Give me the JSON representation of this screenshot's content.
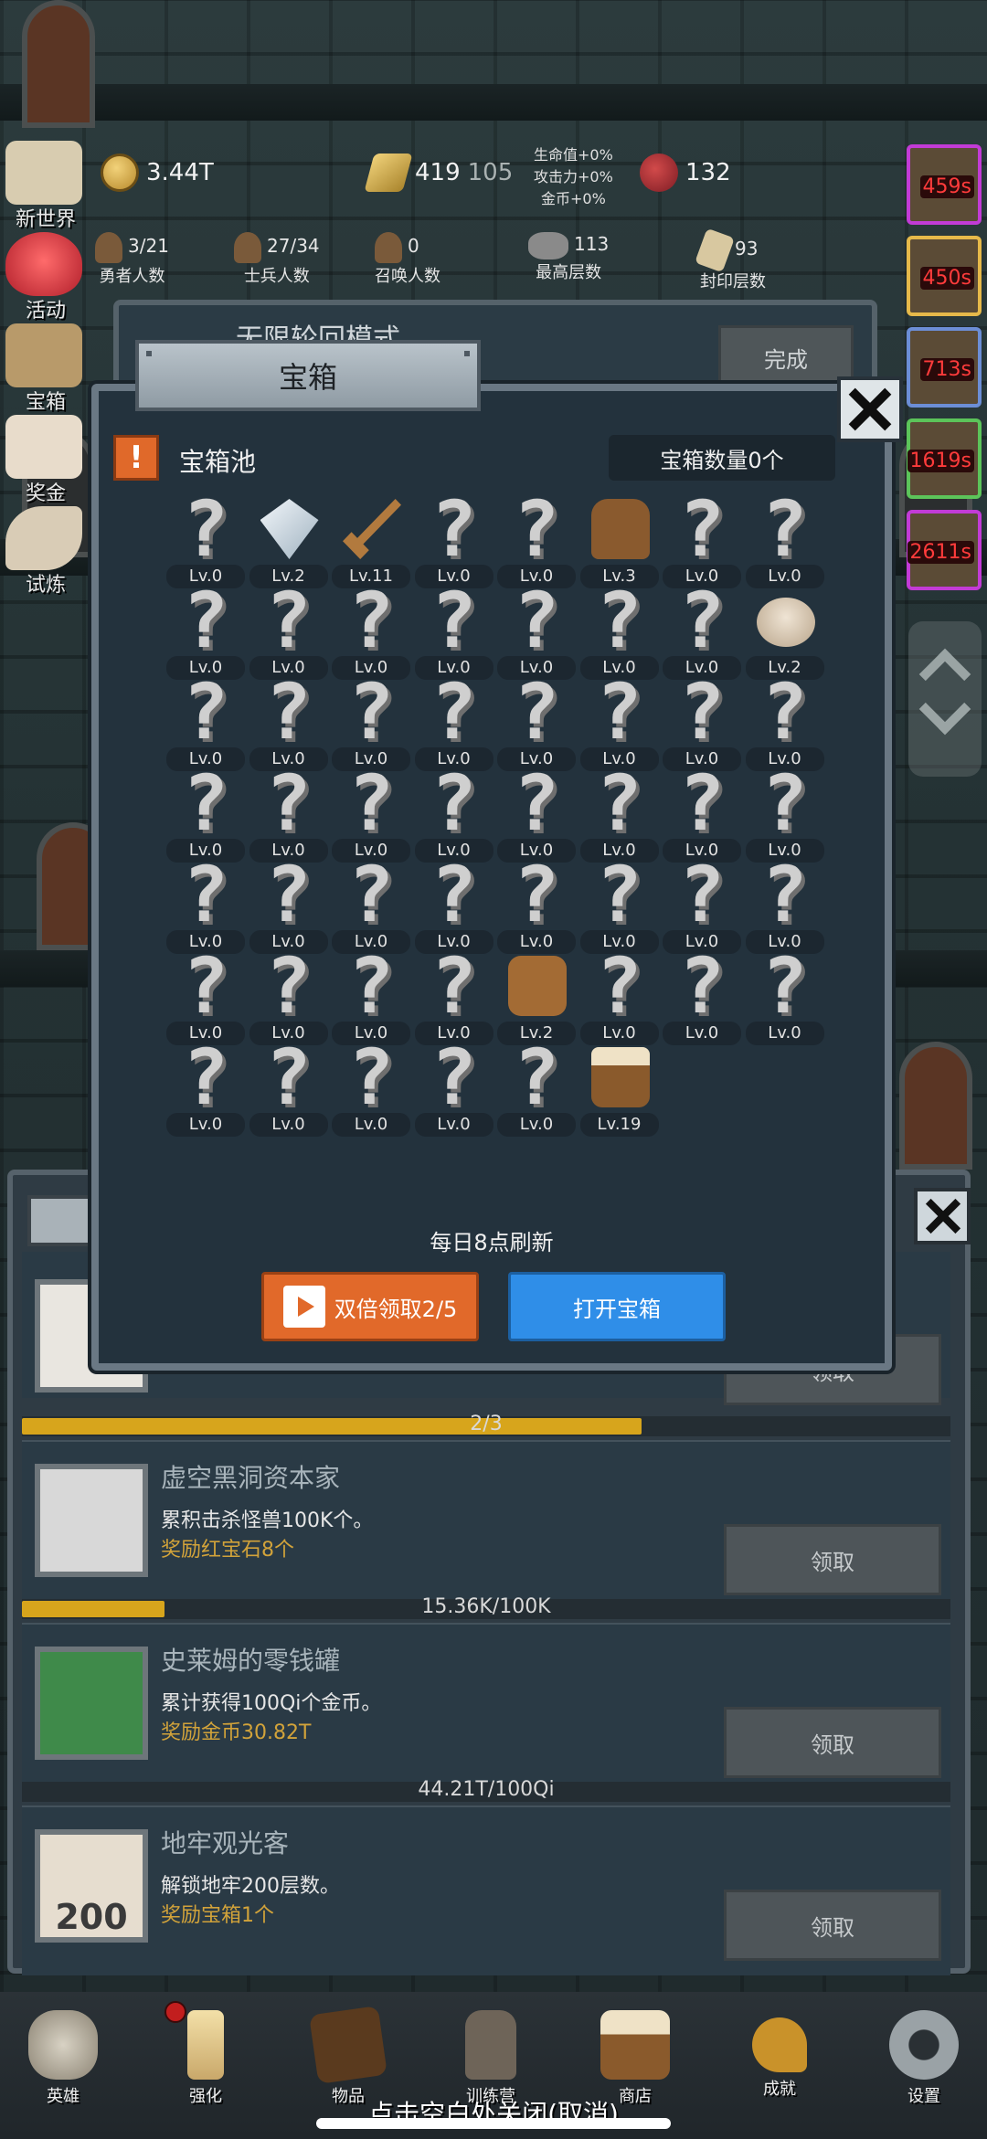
{
  "top_stats": {
    "coins": "3.44T",
    "gold_bars": "419",
    "gold_bars_sub": "105",
    "bonus_lines": [
      "生命值+0%",
      "攻击力+0%",
      "金币+0%"
    ],
    "meat": "132",
    "heroes": {
      "count": "3/21",
      "label": "勇者人数"
    },
    "soldiers": {
      "count": "27/34",
      "label": "士兵人数"
    },
    "summons": {
      "count": "0",
      "label": "召唤人数"
    },
    "highest_floor": {
      "count": "113",
      "label": "最高层数"
    },
    "sealed_floor": {
      "count": "93",
      "label": "封印层数"
    }
  },
  "left_menu": [
    "新世界",
    "活动",
    "宝箱",
    "奖金",
    "试炼"
  ],
  "right_timers": [
    "459s",
    "450s",
    "713s",
    "1619s",
    "2611s"
  ],
  "mode_panel": {
    "title": "无限轮回模式",
    "done_label": "完成"
  },
  "chest_modal": {
    "tab_title": "宝箱",
    "pool_title": "宝箱池",
    "pool_count": "宝箱数量0个",
    "refresh_text": "每日8点刷新",
    "double_claim": "双倍领取2/5",
    "open_chest": "打开宝箱",
    "items": [
      {
        "icon": "unknown",
        "level": "Lv.0"
      },
      {
        "icon": "diamond",
        "level": "Lv.2"
      },
      {
        "icon": "sword",
        "level": "Lv.11"
      },
      {
        "icon": "unknown",
        "level": "Lv.0"
      },
      {
        "icon": "unknown",
        "level": "Lv.0"
      },
      {
        "icon": "armor",
        "level": "Lv.3"
      },
      {
        "icon": "unknown",
        "level": "Lv.0"
      },
      {
        "icon": "unknown",
        "level": "Lv.0"
      },
      {
        "icon": "unknown",
        "level": "Lv.0"
      },
      {
        "icon": "unknown",
        "level": "Lv.0"
      },
      {
        "icon": "unknown",
        "level": "Lv.0"
      },
      {
        "icon": "unknown",
        "level": "Lv.0"
      },
      {
        "icon": "unknown",
        "level": "Lv.0"
      },
      {
        "icon": "unknown",
        "level": "Lv.0"
      },
      {
        "icon": "unknown",
        "level": "Lv.0"
      },
      {
        "icon": "egg",
        "level": "Lv.2"
      },
      {
        "icon": "unknown",
        "level": "Lv.0"
      },
      {
        "icon": "unknown",
        "level": "Lv.0"
      },
      {
        "icon": "unknown",
        "level": "Lv.0"
      },
      {
        "icon": "unknown",
        "level": "Lv.0"
      },
      {
        "icon": "unknown",
        "level": "Lv.0"
      },
      {
        "icon": "unknown",
        "level": "Lv.0"
      },
      {
        "icon": "unknown",
        "level": "Lv.0"
      },
      {
        "icon": "unknown",
        "level": "Lv.0"
      },
      {
        "icon": "unknown",
        "level": "Lv.0"
      },
      {
        "icon": "unknown",
        "level": "Lv.0"
      },
      {
        "icon": "unknown",
        "level": "Lv.0"
      },
      {
        "icon": "unknown",
        "level": "Lv.0"
      },
      {
        "icon": "unknown",
        "level": "Lv.0"
      },
      {
        "icon": "unknown",
        "level": "Lv.0"
      },
      {
        "icon": "unknown",
        "level": "Lv.0"
      },
      {
        "icon": "unknown",
        "level": "Lv.0"
      },
      {
        "icon": "unknown",
        "level": "Lv.0"
      },
      {
        "icon": "unknown",
        "level": "Lv.0"
      },
      {
        "icon": "unknown",
        "level": "Lv.0"
      },
      {
        "icon": "unknown",
        "level": "Lv.0"
      },
      {
        "icon": "unknown",
        "level": "Lv.0"
      },
      {
        "icon": "unknown",
        "level": "Lv.0"
      },
      {
        "icon": "unknown",
        "level": "Lv.0"
      },
      {
        "icon": "unknown",
        "level": "Lv.0"
      },
      {
        "icon": "unknown",
        "level": "Lv.0"
      },
      {
        "icon": "unknown",
        "level": "Lv.0"
      },
      {
        "icon": "unknown",
        "level": "Lv.0"
      },
      {
        "icon": "unknown",
        "level": "Lv.0"
      },
      {
        "icon": "bag",
        "level": "Lv.2"
      },
      {
        "icon": "unknown",
        "level": "Lv.0"
      },
      {
        "icon": "unknown",
        "level": "Lv.0"
      },
      {
        "icon": "unknown",
        "level": "Lv.0"
      },
      {
        "icon": "unknown",
        "level": "Lv.0"
      },
      {
        "icon": "unknown",
        "level": "Lv.0"
      },
      {
        "icon": "unknown",
        "level": "Lv.0"
      },
      {
        "icon": "unknown",
        "level": "Lv.0"
      },
      {
        "icon": "unknown",
        "level": "Lv.0"
      },
      {
        "icon": "beer",
        "level": "Lv.19"
      }
    ]
  },
  "achievements": {
    "first_progress": {
      "text": "2/3",
      "fraction": 0.667
    },
    "rows": [
      {
        "title": "虚空黑洞资本家",
        "desc": "累积击杀怪兽100K个。",
        "reward": "奖励红宝石8个",
        "claim": "领取",
        "progress_text": "15.36K/100K",
        "fraction": 0.154
      },
      {
        "title": "史莱姆的零钱罐",
        "desc": "累计获得100Qi个金币。",
        "reward": "奖励金币30.82T",
        "claim": "领取",
        "progress_text": "44.21T/100Qi",
        "fraction": 0.0
      },
      {
        "title": "地牢观光客",
        "desc": "解锁地牢200层数。",
        "reward": "奖励宝箱1个",
        "claim": "领取",
        "icon_text": "200"
      }
    ],
    "top_claim": "领取"
  },
  "bottom_nav": [
    "英雄",
    "强化",
    "物品",
    "训练营",
    "商店",
    "成就",
    "设置"
  ],
  "close_hint": "点击空白处关闭(取消)"
}
